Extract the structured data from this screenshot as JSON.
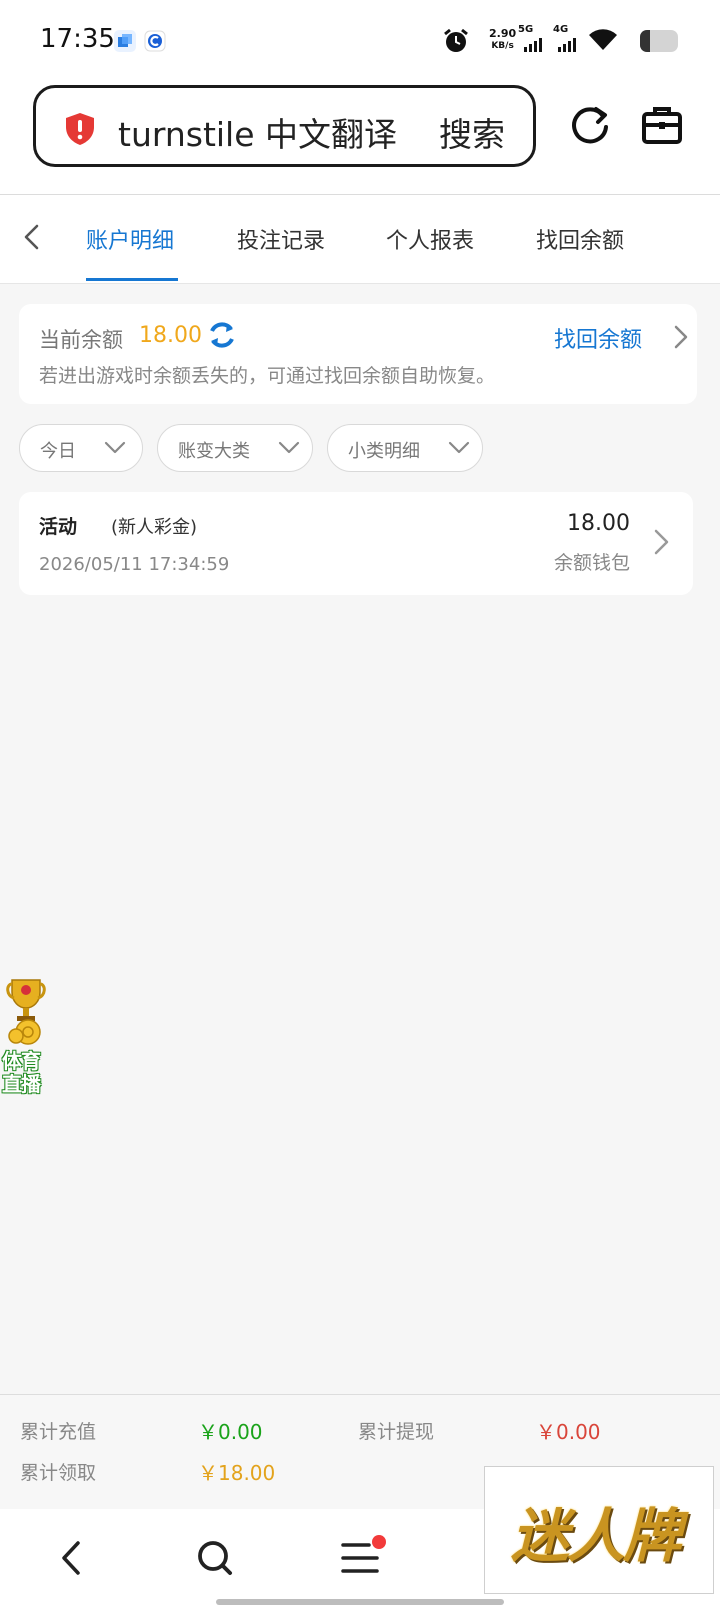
{
  "status_bar": {
    "time": "17:35",
    "net_speed_value": "2.90",
    "net_speed_unit": "KB/s",
    "signal_1": "5G",
    "signal_2": "4G"
  },
  "browser": {
    "search_text": "turnstile 中文翻译",
    "search_button": "搜索"
  },
  "tabs": [
    {
      "label": "账户明细",
      "active": true
    },
    {
      "label": "投注记录",
      "active": false
    },
    {
      "label": "个人报表",
      "active": false
    },
    {
      "label": "找回余额",
      "active": false
    }
  ],
  "balance": {
    "label": "当前余额",
    "value": "18.00",
    "recover_link": "找回余额",
    "hint": "若进出游戏时余额丢失的，可通过找回余额自助恢复。"
  },
  "filters": [
    {
      "label": "今日"
    },
    {
      "label": "账变大类"
    },
    {
      "label": "小类明细"
    }
  ],
  "records": [
    {
      "title": "活动",
      "subtitle": "(新人彩金)",
      "time": "2026/05/11 17:34:59",
      "amount": "18.00",
      "wallet": "余额钱包"
    }
  ],
  "floating_badge": {
    "line1": "体育",
    "line2": "直播"
  },
  "summary": {
    "recharge_label": "累计充值",
    "recharge_value": "￥0.00",
    "withdraw_label": "累计提现",
    "withdraw_value": "￥0.00",
    "claim_label": "累计领取",
    "claim_value": "￥18.00"
  },
  "colors": {
    "accent_blue": "#1677d2",
    "balance_yellow": "#f0a81c",
    "recharge_green": "#1aa31a",
    "withdraw_red": "#d9453a",
    "claim_yellow": "#e3a31c"
  },
  "brand_overlay": "迷人牌"
}
